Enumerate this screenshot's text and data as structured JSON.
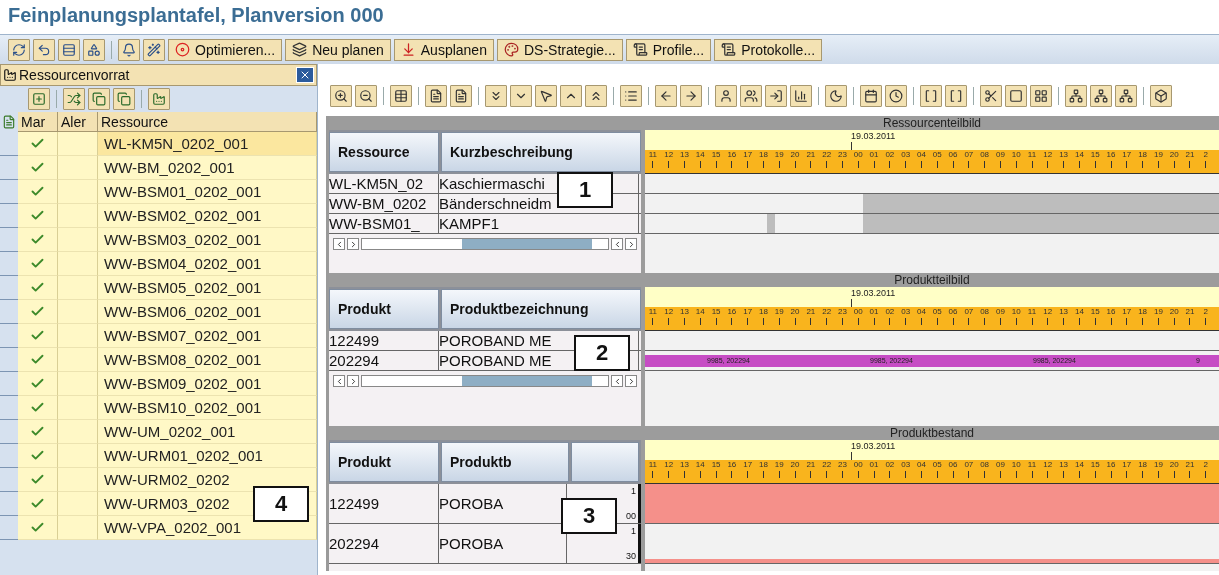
{
  "title": "Feinplanungsplantafel, Planversion 000",
  "toolbar": {
    "buttons": [
      {
        "label": "Optimieren..."
      },
      {
        "label": "Neu planen"
      },
      {
        "label": "Ausplanen"
      },
      {
        "label": "DS-Strategie..."
      },
      {
        "label": "Profile..."
      },
      {
        "label": "Protokolle..."
      }
    ]
  },
  "resource_pool": {
    "title": "Ressourcenvorrat",
    "columns": [
      "Mar",
      "Aler",
      "Ressource"
    ],
    "callout": "4",
    "rows": [
      {
        "name": "WL-KM5N_0202_001",
        "checked": true,
        "selected": true
      },
      {
        "name": "WW-BM_0202_001",
        "checked": true,
        "selected": false
      },
      {
        "name": "WW-BSM01_0202_001",
        "checked": true,
        "selected": false
      },
      {
        "name": "WW-BSM02_0202_001",
        "checked": true,
        "selected": false
      },
      {
        "name": "WW-BSM03_0202_001",
        "checked": true,
        "selected": false
      },
      {
        "name": "WW-BSM04_0202_001",
        "checked": true,
        "selected": false
      },
      {
        "name": "WW-BSM05_0202_001",
        "checked": true,
        "selected": false
      },
      {
        "name": "WW-BSM06_0202_001",
        "checked": true,
        "selected": false
      },
      {
        "name": "WW-BSM07_0202_001",
        "checked": true,
        "selected": false
      },
      {
        "name": "WW-BSM08_0202_001",
        "checked": true,
        "selected": false
      },
      {
        "name": "WW-BSM09_0202_001",
        "checked": true,
        "selected": false
      },
      {
        "name": "WW-BSM10_0202_001",
        "checked": true,
        "selected": false
      },
      {
        "name": "WW-UM_0202_001",
        "checked": true,
        "selected": false
      },
      {
        "name": "WW-URM01_0202_001",
        "checked": true,
        "selected": false
      },
      {
        "name": "WW-URM02_0202",
        "checked": true,
        "selected": false
      },
      {
        "name": "WW-URM03_0202",
        "checked": true,
        "selected": false
      },
      {
        "name": "WW-VPA_0202_001",
        "checked": true,
        "selected": false
      }
    ]
  },
  "sections": [
    {
      "kind": "resources",
      "title": "Ressourcenteilbild",
      "callout": "1",
      "columns": [
        "Ressource",
        "Kurzbeschreibung"
      ],
      "date": "19.03.2011",
      "hours": [
        "11",
        "12",
        "13",
        "14",
        "15",
        "16",
        "17",
        "18",
        "19",
        "20",
        "21",
        "22",
        "23",
        "00",
        "01",
        "02",
        "03",
        "04",
        "05",
        "06",
        "07",
        "08",
        "09",
        "10",
        "11",
        "12",
        "13",
        "14",
        "15",
        "16",
        "17",
        "18",
        "19",
        "20",
        "21",
        "2"
      ],
      "rows": [
        {
          "cells": [
            "WL-KM5N_02",
            "Kaschiermaschi"
          ]
        },
        {
          "cells": [
            "WW-BM_0202",
            "Bänderschneidm"
          ]
        },
        {
          "cells": [
            "WW-BSM01_",
            "KAMPF1"
          ]
        }
      ]
    },
    {
      "kind": "products",
      "title": "Produktteilbild",
      "callout": "2",
      "columns": [
        "Produkt",
        "Produktbezeichnung"
      ],
      "date": "19.03.2011",
      "hours": [
        "11",
        "12",
        "13",
        "14",
        "15",
        "16",
        "17",
        "18",
        "19",
        "20",
        "21",
        "22",
        "23",
        "00",
        "01",
        "02",
        "03",
        "04",
        "05",
        "06",
        "07",
        "08",
        "09",
        "10",
        "11",
        "12",
        "13",
        "14",
        "15",
        "16",
        "17",
        "18",
        "19",
        "20",
        "21",
        "2"
      ],
      "rows": [
        {
          "cells": [
            "122499",
            "POROBAND ME"
          ],
          "bar_labels": []
        },
        {
          "cells": [
            "202294",
            "POROBAND ME"
          ],
          "bar_labels": [
            "9985, 202294",
            "9985, 202294",
            "9985, 202294",
            "9"
          ]
        }
      ]
    },
    {
      "kind": "stock",
      "title": "Produktbestand",
      "callout": "3",
      "columns": [
        "Produkt",
        "Produktb",
        ""
      ],
      "date": "19.03.2011",
      "hours": [
        "11",
        "12",
        "13",
        "14",
        "15",
        "16",
        "17",
        "18",
        "19",
        "20",
        "21",
        "22",
        "23",
        "00",
        "01",
        "02",
        "03",
        "04",
        "05",
        "06",
        "07",
        "08",
        "09",
        "10",
        "11",
        "12",
        "13",
        "14",
        "15",
        "16",
        "17",
        "18",
        "19",
        "20",
        "21",
        "2"
      ],
      "rows": [
        {
          "cells": [
            "122499",
            "POROBA"
          ],
          "axis": [
            "1",
            "00"
          ]
        },
        {
          "cells": [
            "202294",
            "POROBA"
          ],
          "axis": [
            "1",
            "30"
          ]
        }
      ]
    }
  ]
}
